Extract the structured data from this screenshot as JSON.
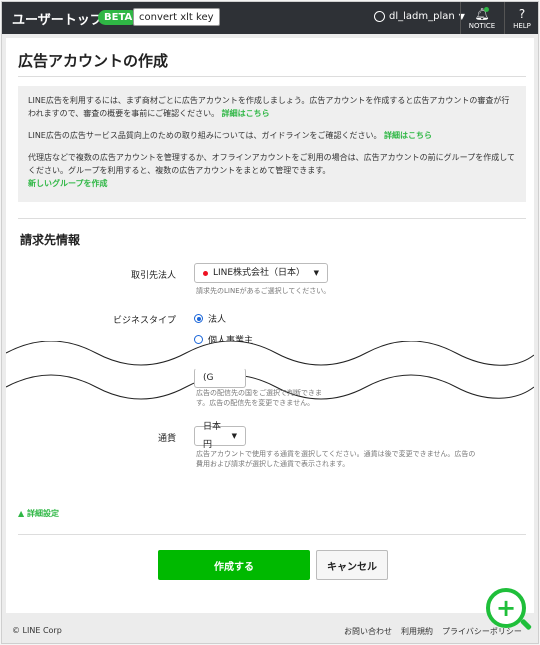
{
  "topbar": {
    "title": "ユーザートップ",
    "badge": "BETA",
    "key_label": "convert xlt key",
    "user_name": "dl_ladm_plan",
    "notice_label": "NOTICE",
    "help_label": "HELP"
  },
  "page": {
    "title": "広告アカウントの作成"
  },
  "info": {
    "p1": "LINE広告を利用するには、まず商材ごとに広告アカウントを作成しましょう。広告アカウントを作成すると広告アカウントの審査が行われますので、審査の概要を事前にご確認ください。",
    "p1_link": "詳細はこちら",
    "p2": "LINE広告の広告サービス品質向上のための取り組みについては、ガイドラインをご確認ください。",
    "p2_link": "詳細はこちら",
    "p3": "代理店などで複数の広告アカウントを管理するか、オフラインアカウントをご利用の場合は、広告アカウントの前にグループを作成してください。グループを利用すると、複数の広告アカウントをまとめて管理できます。",
    "p3_link": "新しいグループを作成"
  },
  "billing": {
    "section_title": "請求先情報",
    "company_label": "取引先法人",
    "company_value": "LINE株式会社（日本）",
    "company_help": "請求先のLINEがあるご選択してください。",
    "biz_type_label": "ビジネスタイプ",
    "biz_type_options": [
      "法人",
      "個人事業主"
    ],
    "biz_type_selected": "法人",
    "partial_field_value": "(G",
    "partial_help": "広告の配信先の国をご選択で判断できます。広告の配信先を変更できません。",
    "currency_label": "通貨",
    "currency_value": "日本円",
    "currency_help": "広告アカウントで使用する通貨を選択してください。通貨は後で変更できません。広告の費用および請求が選択した通貨で表示されます。"
  },
  "advanced_label": "詳細設定",
  "buttons": {
    "create": "作成する",
    "cancel": "キャンセル"
  },
  "footer": {
    "copyright": "© LINE Corp",
    "links": [
      "お問い合わせ",
      "利用規約",
      "プライバシーポリシー"
    ]
  }
}
